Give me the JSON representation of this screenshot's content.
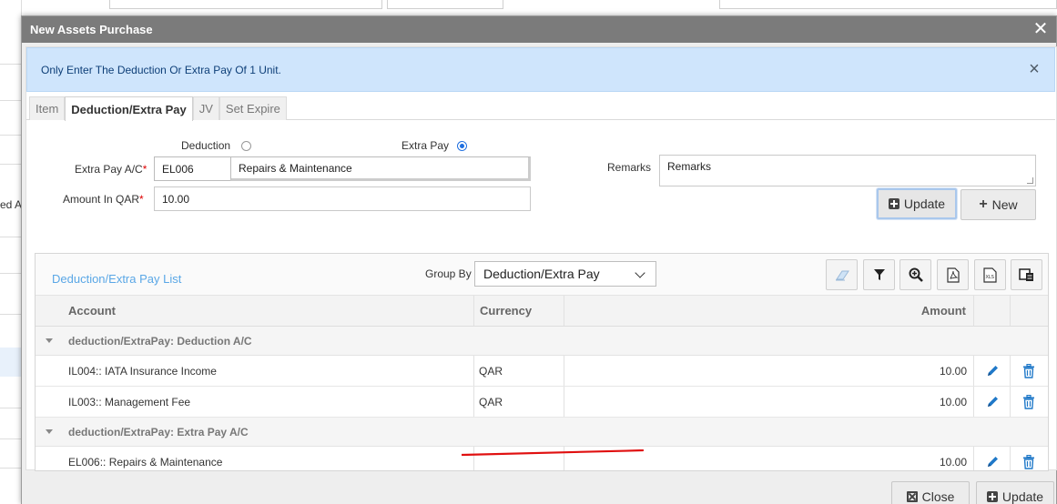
{
  "modal": {
    "title": "New Assets Purchase",
    "alert_text": "Only Enter The Deduction Or Extra Pay Of 1 Unit."
  },
  "background": {
    "left_text": "ed As"
  },
  "tabs": [
    {
      "label": "Item",
      "active": false
    },
    {
      "label": "Deduction/Extra Pay",
      "active": true
    },
    {
      "label": "JV",
      "active": false
    },
    {
      "label": "Set Expire",
      "active": false
    }
  ],
  "form": {
    "type_options": [
      {
        "label": "Deduction",
        "selected": false
      },
      {
        "label": "Extra Pay",
        "selected": true
      }
    ],
    "account_label": "Extra Pay A/C",
    "account_code": "EL006",
    "account_name": "Repairs & Maintenance",
    "amount_label": "Amount In QAR",
    "amount_value": "10.00",
    "remarks_label": "Remarks",
    "remarks_value": "Remarks",
    "update_label": "Update",
    "new_label": "New"
  },
  "grid": {
    "title": "Deduction/Extra Pay List",
    "group_by_label": "Group By",
    "group_by_value": "Deduction/Extra Pay",
    "columns": [
      "Account",
      "Currency",
      "Amount"
    ],
    "groups": [
      {
        "title": "deduction/ExtraPay: Deduction A/C",
        "rows": [
          {
            "account": "IL004:: IATA Insurance Income",
            "currency": "QAR",
            "amount": "10.00"
          },
          {
            "account": "IL003:: Management Fee",
            "currency": "QAR",
            "amount": "10.00"
          }
        ]
      },
      {
        "title": "deduction/ExtraPay: Extra Pay A/C",
        "rows": [
          {
            "account": "EL006:: Repairs & Maintenance",
            "currency": "",
            "amount": "10.00"
          }
        ]
      }
    ]
  },
  "footer": {
    "close_label": "Close",
    "update_label": "Update"
  },
  "colors": {
    "header": "#7b7b7b",
    "alert_bg": "#cfe5fc",
    "link_blue": "#5aa7e6",
    "action_blue": "#1f78c8",
    "annotation_red": "#e01010"
  }
}
